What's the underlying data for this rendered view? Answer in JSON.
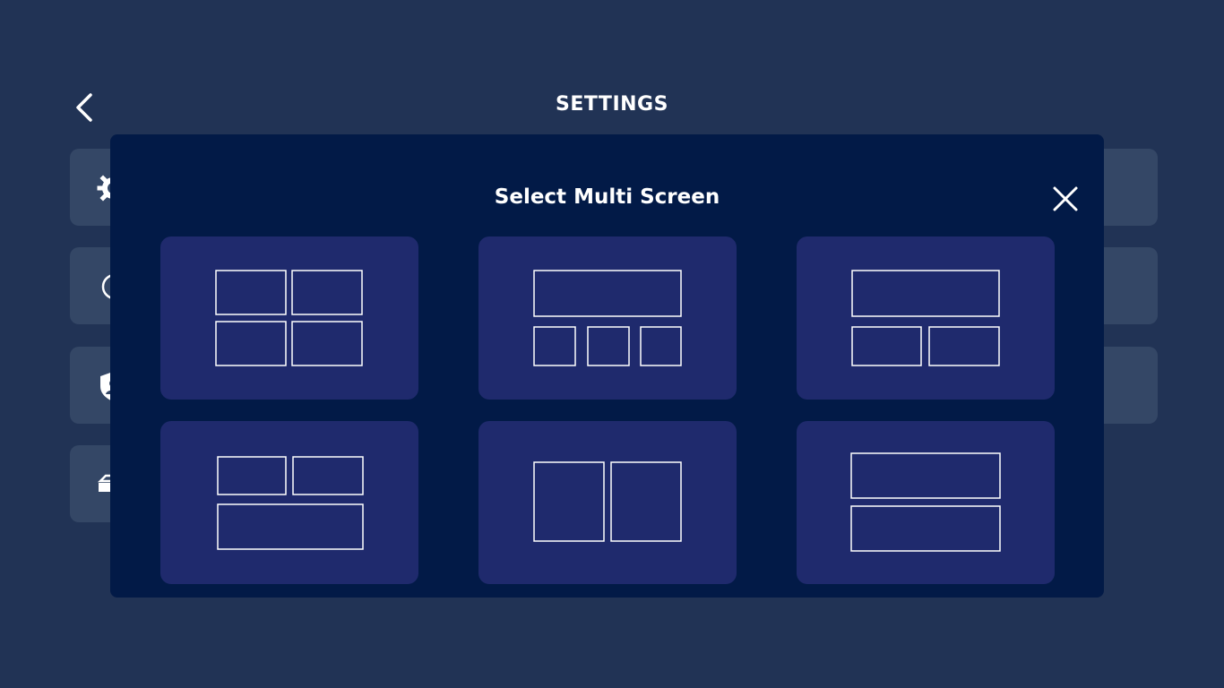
{
  "header": {
    "title": "SETTINGS",
    "back_icon": "chevron-left-icon"
  },
  "background_rows": [
    {
      "icon": "gear-icon"
    },
    {
      "icon": "info-icon"
    },
    {
      "icon": "shield-user-icon"
    },
    {
      "icon": "drive-icon"
    }
  ],
  "dialog": {
    "title": "Select Multi Screen",
    "close_icon": "close-icon",
    "layouts": [
      {
        "id": "grid-2x2",
        "panes": 4
      },
      {
        "id": "one-top-three-bottom",
        "panes": 4
      },
      {
        "id": "one-top-two-bottom",
        "panes": 3
      },
      {
        "id": "two-top-one-bottom",
        "panes": 3
      },
      {
        "id": "two-side-by-side",
        "panes": 2
      },
      {
        "id": "two-stacked",
        "panes": 2
      }
    ]
  },
  "colors": {
    "page_bg": "#213355",
    "row_bg": "#344766",
    "dialog_bg": "#021a47",
    "card_bg": "#1f2a6d",
    "pane_stroke": "#ffffff"
  }
}
